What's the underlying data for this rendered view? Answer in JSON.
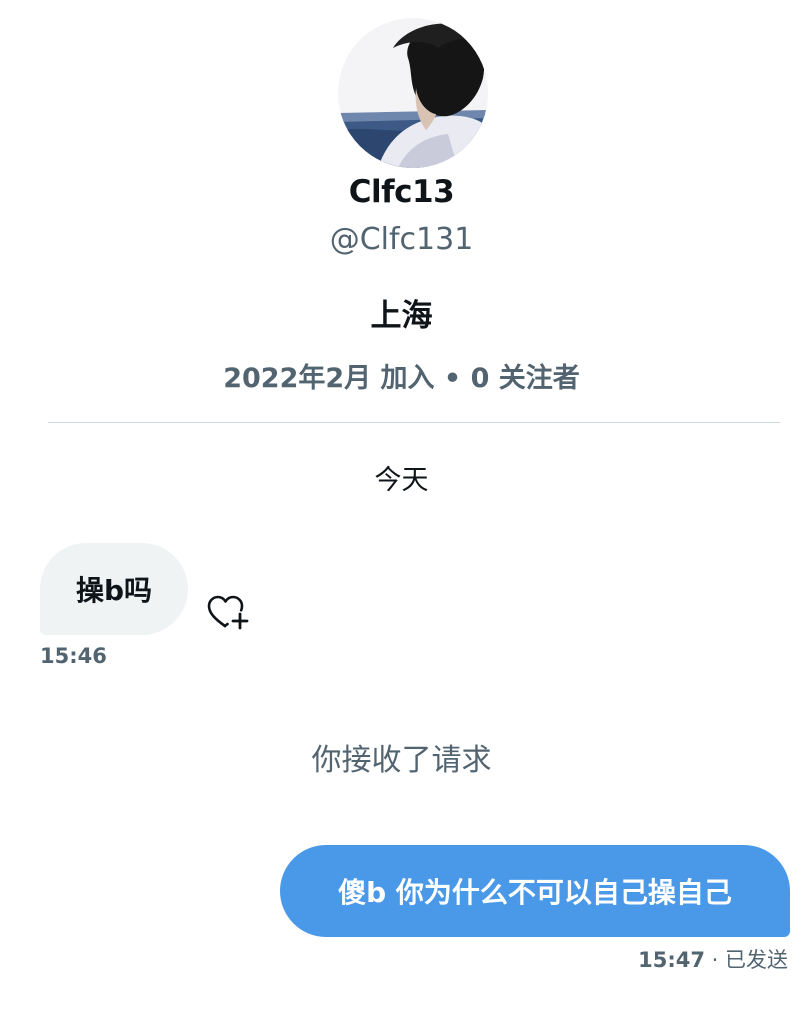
{
  "profile": {
    "display_name": "Clfc13",
    "handle": "@Clfc131",
    "location": "上海",
    "meta": "2022年2月 加入 • 0 关注者"
  },
  "conversation": {
    "day_label": "今天",
    "incoming": {
      "text": "操b吗",
      "time": "15:46"
    },
    "system_note": "你接收了请求",
    "outgoing": {
      "text": "傻b 你为什么不可以自己操自己",
      "time": "15:47",
      "status": " · 已发送"
    }
  },
  "icons": {
    "like": "heart-plus-icon"
  },
  "colors": {
    "outgoing_bubble": "#4a99e9",
    "incoming_bubble": "#eff3f4",
    "secondary_text": "#536471"
  }
}
